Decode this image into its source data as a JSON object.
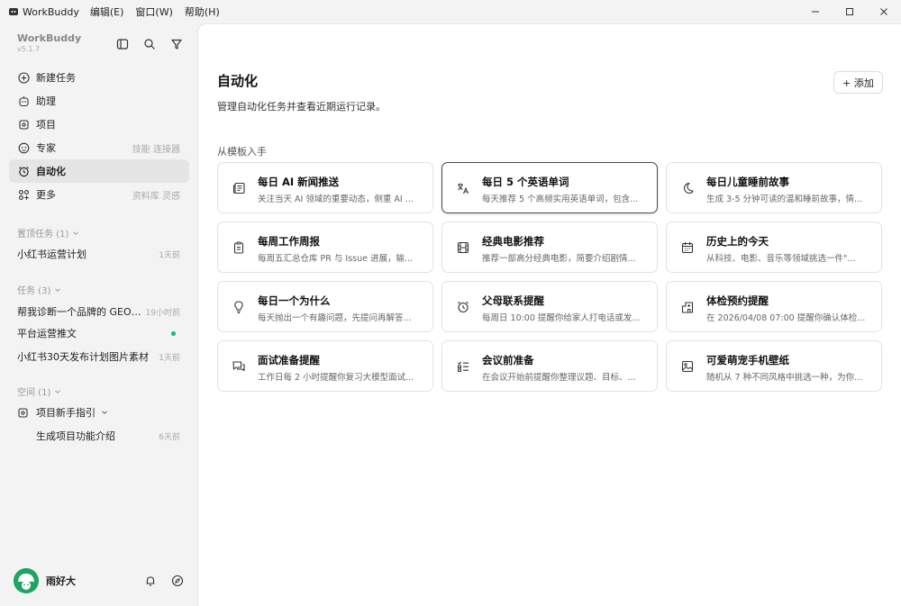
{
  "window": {
    "app_name": "WorkBuddy",
    "menus": [
      "编辑(E)",
      "窗口(W)",
      "帮助(H)"
    ]
  },
  "sidebar": {
    "brand_name": "WorkBuddy",
    "brand_version": "v5.1.7",
    "nav": [
      {
        "label": "新建任务",
        "hint": "",
        "icon": "plus-circle-icon"
      },
      {
        "label": "助理",
        "hint": "",
        "icon": "assistant-icon"
      },
      {
        "label": "项目",
        "hint": "",
        "icon": "project-icon"
      },
      {
        "label": "专家",
        "hint": "技能 连接器",
        "icon": "expert-icon"
      },
      {
        "label": "自动化",
        "hint": "",
        "icon": "alarm-icon",
        "active": true
      },
      {
        "label": "更多",
        "hint": "资料库 灵感",
        "icon": "grid-icon"
      }
    ],
    "pinned": {
      "label": "置顶任务 (1)",
      "items": [
        {
          "label": "小红书运营计划",
          "time": "1天前"
        }
      ]
    },
    "tasks": {
      "label": "任务 (3)",
      "items": [
        {
          "label": "帮我诊断一个品牌的 GEO ...",
          "time": "19小时前"
        },
        {
          "label": "平台运营推文",
          "time": ""
        },
        {
          "label": "小红书30天发布计划图片素材",
          "time": "1天前"
        }
      ]
    },
    "spaces": {
      "label": "空间 (1)",
      "project": "项目新手指引",
      "items": [
        {
          "label": "生成项目功能介绍",
          "time": "6天前"
        }
      ]
    },
    "user": {
      "name": "雨好大"
    }
  },
  "main": {
    "title": "自动化",
    "subtitle": "管理自动化任务并查看近期运行记录。",
    "add_label": "+ 添加",
    "section_title": "从模板入手",
    "cards": [
      {
        "title": "每日 AI 新闻推送",
        "desc": "关注当天 AI 领域的重要动态，侧重 AI ...",
        "icon": "newspaper-icon"
      },
      {
        "title": "每日 5 个英语单词",
        "desc": "每天推荐 5 个高频实用英语单词，包含...",
        "icon": "translate-icon",
        "highlight": true
      },
      {
        "title": "每日儿童睡前故事",
        "desc": "生成 3-5 分钟可读的温和睡前故事，情...",
        "icon": "moon-icon"
      },
      {
        "title": "每周工作周报",
        "desc": "每周五汇总仓库 PR 与 Issue 进展，输...",
        "icon": "clipboard-icon"
      },
      {
        "title": "经典电影推荐",
        "desc": "推荐一部高分经典电影，简要介绍剧情...",
        "icon": "film-icon"
      },
      {
        "title": "历史上的今天",
        "desc": "从科技、电影、音乐等领域挑选一件\"...",
        "icon": "calendar-icon"
      },
      {
        "title": "每日一个为什么",
        "desc": "每天抛出一个有趣问题，先提问再解答...",
        "icon": "lightbulb-icon"
      },
      {
        "title": "父母联系提醒",
        "desc": "每周日 10:00 提醒你给家人打电话或发...",
        "icon": "alarm-clock-icon"
      },
      {
        "title": "体检预约提醒",
        "desc": "在 2026/04/08 07:00 提醒你确认体检...",
        "icon": "hospital-icon"
      },
      {
        "title": "面试准备提醒",
        "desc": "工作日每 2 小时提醒你复习大模型面试...",
        "icon": "chat-icon"
      },
      {
        "title": "会议前准备",
        "desc": "在会议开始前提醒你整理议题、目标、...",
        "icon": "checklist-icon"
      },
      {
        "title": "可爱萌宠手机壁纸",
        "desc": "随机从 7 种不同风格中挑选一种，为你...",
        "icon": "image-icon"
      }
    ]
  }
}
